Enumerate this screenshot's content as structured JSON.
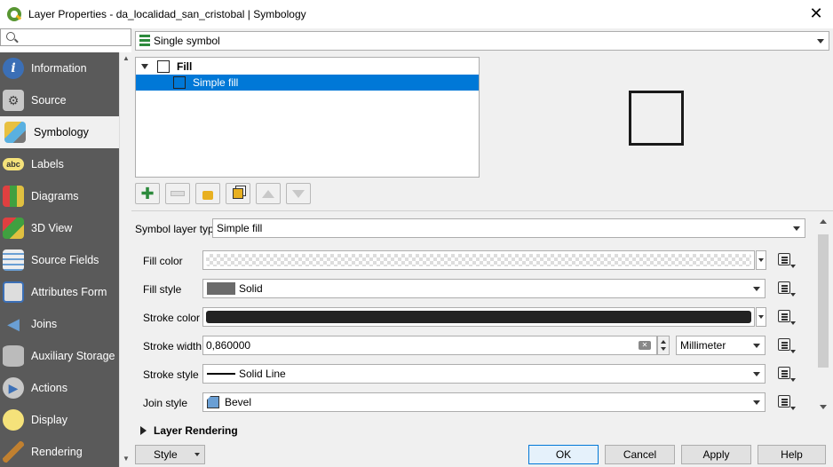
{
  "window": {
    "title": "Layer Properties - da_localidad_san_cristobal | Symbology",
    "close_glyph": "✕"
  },
  "sidebar": {
    "search_placeholder": "",
    "items": [
      {
        "label": "Information",
        "icon": "info-icon"
      },
      {
        "label": "Source",
        "icon": "source-icon"
      },
      {
        "label": "Symbology",
        "icon": "symbology-icon",
        "active": true
      },
      {
        "label": "Labels",
        "icon": "labels-icon",
        "glyph": "abc"
      },
      {
        "label": "Diagrams",
        "icon": "diagrams-icon"
      },
      {
        "label": "3D View",
        "icon": "3d-view-icon"
      },
      {
        "label": "Source Fields",
        "icon": "source-fields-icon"
      },
      {
        "label": "Attributes Form",
        "icon": "attributes-form-icon"
      },
      {
        "label": "Joins",
        "icon": "joins-icon"
      },
      {
        "label": "Auxiliary Storage",
        "icon": "auxiliary-storage-icon"
      },
      {
        "label": "Actions",
        "icon": "actions-icon"
      },
      {
        "label": "Display",
        "icon": "display-icon"
      },
      {
        "label": "Rendering",
        "icon": "rendering-icon"
      }
    ]
  },
  "renderer": {
    "selected": "Single symbol"
  },
  "symbol_tree": {
    "items": [
      {
        "label": "Fill"
      },
      {
        "label": "Simple fill"
      }
    ]
  },
  "symbol_layer": {
    "type_label": "Symbol layer type",
    "type_value": "Simple fill",
    "fields": {
      "fill_color_label": "Fill color",
      "fill_style_label": "Fill style",
      "fill_style_value": "Solid",
      "stroke_color_label": "Stroke color",
      "stroke_width_label": "Stroke width",
      "stroke_width_value": "0,860000",
      "stroke_width_unit": "Millimeter",
      "stroke_style_label": "Stroke style",
      "stroke_style_value": "Solid Line",
      "join_style_label": "Join style",
      "join_style_value": "Bevel"
    }
  },
  "sections": {
    "layer_rendering": "Layer Rendering"
  },
  "footer": {
    "style_label": "Style",
    "ok_label": "OK",
    "cancel_label": "Cancel",
    "apply_label": "Apply",
    "help_label": "Help"
  },
  "colors": {
    "fill_style_swatch": "#6b6b6b",
    "stroke_color": "#232323",
    "selection": "#0078d7",
    "sidebar_bg": "#5a5a5a"
  }
}
